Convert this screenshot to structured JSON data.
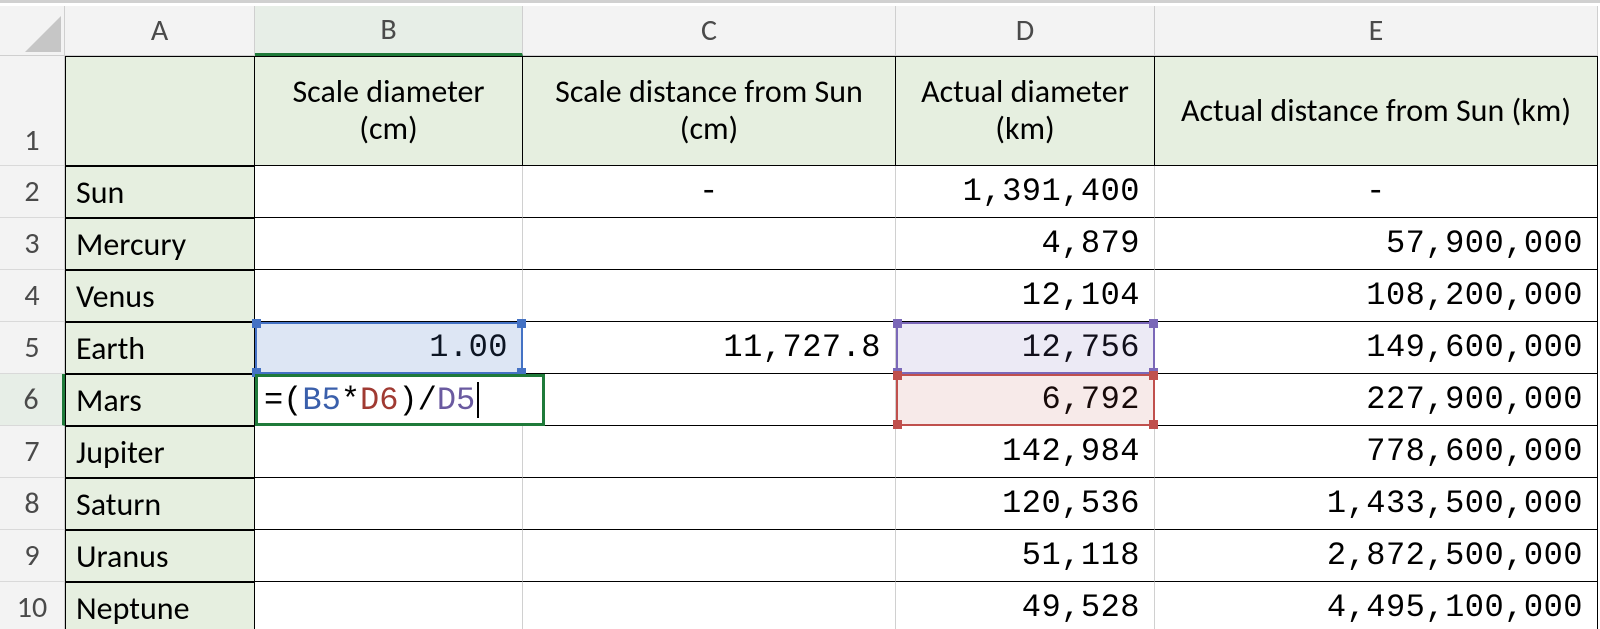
{
  "columns": {
    "A": "A",
    "B": "B",
    "C": "C",
    "D": "D",
    "E": "E"
  },
  "row_numbers": [
    "1",
    "2",
    "3",
    "4",
    "5",
    "6",
    "7",
    "8",
    "9",
    "10"
  ],
  "headers": {
    "A": "",
    "B": "Scale diameter (cm)",
    "C": "Scale distance from Sun (cm)",
    "D": "Actual diameter (km)",
    "E": "Actual distance from Sun (km)"
  },
  "rows": [
    {
      "A": "Sun",
      "B": "",
      "C": "-",
      "D": "1,391,400",
      "E": "-"
    },
    {
      "A": "Mercury",
      "B": "",
      "C": "",
      "D": "4,879",
      "E": "57,900,000"
    },
    {
      "A": "Venus",
      "B": "",
      "C": "",
      "D": "12,104",
      "E": "108,200,000"
    },
    {
      "A": "Earth",
      "B": "1.00",
      "C": "11,727.8",
      "D": "12,756",
      "E": "149,600,000"
    },
    {
      "A": "Mars",
      "B": "",
      "C": "",
      "D": "6,792",
      "E": "227,900,000"
    },
    {
      "A": "Jupiter",
      "B": "",
      "C": "",
      "D": "142,984",
      "E": "778,600,000"
    },
    {
      "A": "Saturn",
      "B": "",
      "C": "",
      "D": "120,536",
      "E": "1,433,500,000"
    },
    {
      "A": "Uranus",
      "B": "",
      "C": "",
      "D": "51,118",
      "E": "2,872,500,000"
    },
    {
      "A": "Neptune",
      "B": "",
      "C": "",
      "D": "49,528",
      "E": "4,495,100,000"
    }
  ],
  "active_edit": {
    "cell": "B6",
    "formula_tokens": [
      {
        "t": "eq",
        "v": "="
      },
      {
        "t": "par",
        "v": "("
      },
      {
        "t": "B5",
        "v": "B5"
      },
      {
        "t": "op",
        "v": "*"
      },
      {
        "t": "D6",
        "v": "D6"
      },
      {
        "t": "par",
        "v": ")"
      },
      {
        "t": "op",
        "v": "/"
      },
      {
        "t": "D5",
        "v": "D5"
      }
    ],
    "formula_plain": "=(B5*D6)/D5"
  },
  "active_column": "B",
  "active_row": "6",
  "referenced_cells": [
    "B5",
    "D5",
    "D6"
  ]
}
